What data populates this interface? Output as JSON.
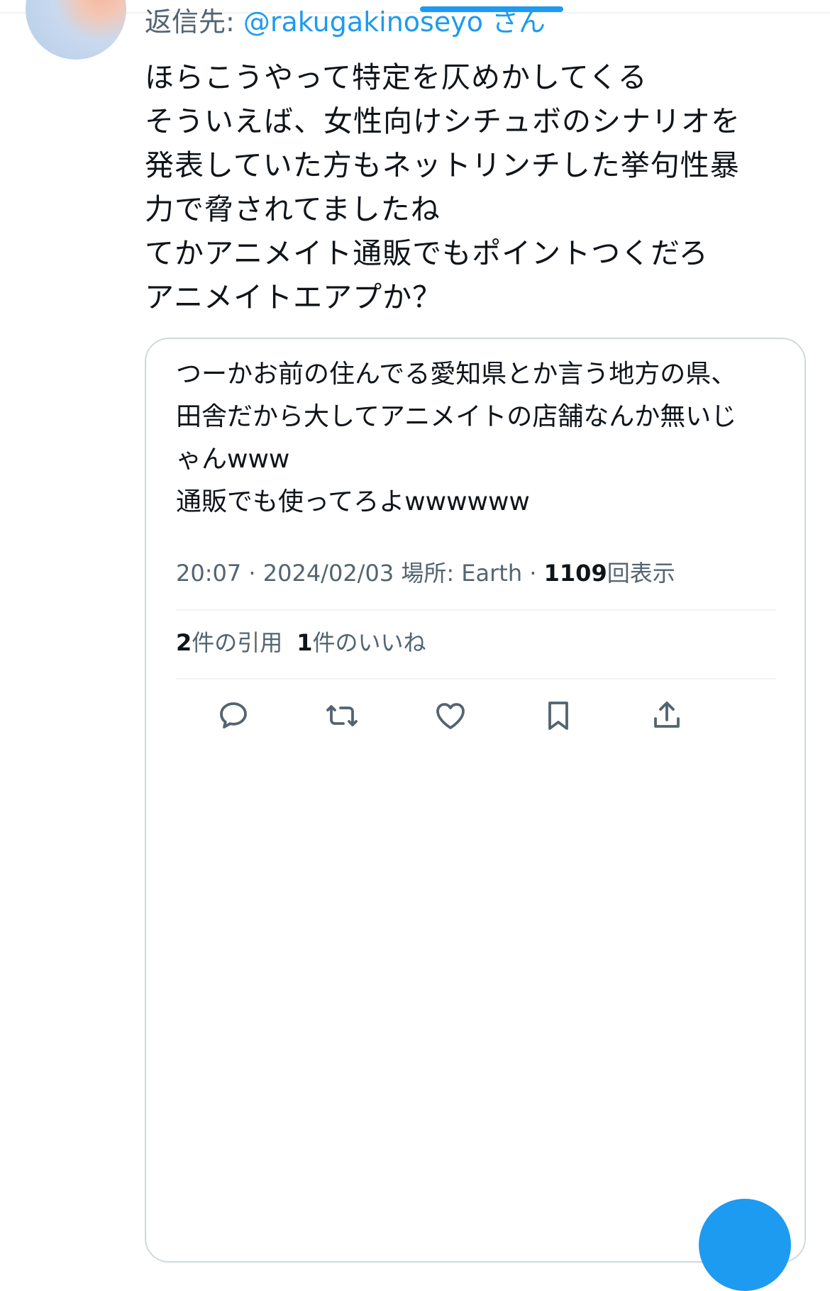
{
  "reply": {
    "prefix": "返信先: ",
    "handle": "@rakugakinoseyo",
    "suffix": " さん"
  },
  "tweet": {
    "text": "ほらこうやって特定を仄めかしてくる\nそういえば、女性向けシチュボのシナリオを\n発表していた方もネットリンチした挙句性暴\n力で脅されてましたね\nてかアニメイト通販でもポイントつくだろ\nアニメイトエアプか？"
  },
  "quote": {
    "text": "つーかお前の住んでる愛知県とか言う地方の県、\n田舎だから大してアニメイトの店舗なんか無いじ\nゃんwww\n通販でも使ってろよwwwwww",
    "timestamp": "20:07 · 2024/02/03 場所: Earth · ",
    "views_count": "1109",
    "views_label": "回表示",
    "quotes_count": "2",
    "quotes_label": "件の引用",
    "likes_count": "1",
    "likes_label": "件のいいね"
  },
  "actions": {
    "reply_icon": "reply-icon",
    "retweet_icon": "retweet-icon",
    "like_icon": "heart-icon",
    "bookmark_icon": "bookmark-icon",
    "share_icon": "share-icon"
  },
  "colors": {
    "accent": "#1d9bf0",
    "secondary_text": "#536471",
    "primary_text": "#0f1419",
    "border": "#cfd9de"
  }
}
